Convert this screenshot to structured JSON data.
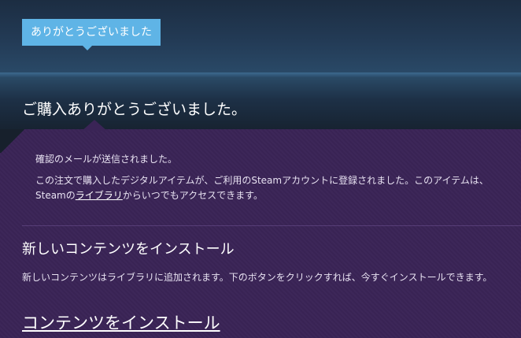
{
  "banner": {
    "tag_label": "ありがとうございました"
  },
  "header": {
    "title": "ご購入ありがとうございました。"
  },
  "confirmation": {
    "email_sent": "確認のメールが送信されました。",
    "registered_text_before": "この注文で購入したデジタルアイテムが、ご利用のSteamアカウントに登録されました。このアイテムは、Steamの",
    "library_link": "ライブラリ",
    "registered_text_after": "からいつでもアクセスできます。"
  },
  "install_section": {
    "title": "新しいコンテンツをインストール",
    "description": "新しいコンテンツはライブラリに追加されます。下のボタンをクリックすれば、今すぐインストールできます。",
    "install_link": "コンテンツをインストール"
  },
  "colors": {
    "tag_background": "#5fb4e6",
    "panel_background": "#3a2456",
    "page_background": "#1b2838"
  }
}
